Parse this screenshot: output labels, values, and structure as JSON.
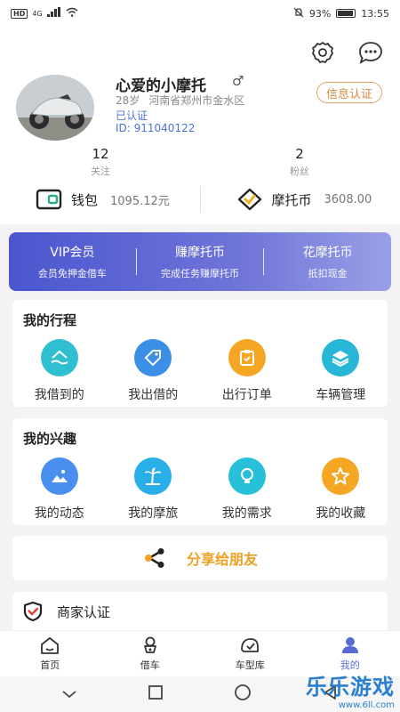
{
  "status_bar": {
    "hd": "HD",
    "network": "4G",
    "battery": "93%",
    "battery_level": 0.93,
    "time": "13:55"
  },
  "profile": {
    "name": "心爱的小摩托",
    "gender_symbol": "♂",
    "age": "28岁",
    "location": "河南省郑州市金水区",
    "verified_text": "已认证",
    "id_text": "ID: 911040122",
    "cert_button": "信息认证"
  },
  "stats": {
    "following_count": "12",
    "following_label": "关注",
    "fans_count": "2",
    "fans_label": "粉丝"
  },
  "wallet": {
    "wallet_label": "钱包",
    "wallet_value": "1095.12元",
    "coin_label": "摩托币",
    "coin_value": "3608.00"
  },
  "vip_banner": [
    {
      "title": "VIP会员",
      "sub": "会员免押金借车"
    },
    {
      "title": "赚摩托币",
      "sub": "完成任务赚摩托币"
    },
    {
      "title": "花摩托币",
      "sub": "抵扣现金"
    }
  ],
  "trips": {
    "title": "我的行程",
    "items": [
      {
        "label": "我借到的",
        "icon": "borrowed-icon",
        "color": "#2fbfd0"
      },
      {
        "label": "我出借的",
        "icon": "tag-icon",
        "color": "#3b8fe6"
      },
      {
        "label": "出行订单",
        "icon": "order-icon",
        "color": "#f5a623"
      },
      {
        "label": "车辆管理",
        "icon": "layers-icon",
        "color": "#27b6d6"
      }
    ]
  },
  "interests": {
    "title": "我的兴趣",
    "items": [
      {
        "label": "我的动态",
        "icon": "image-icon",
        "color": "#4a8ff0"
      },
      {
        "label": "我的摩旅",
        "icon": "palm-tree-icon",
        "color": "#2aaee8"
      },
      {
        "label": "我的需求",
        "icon": "bulb-icon",
        "color": "#27c0d8"
      },
      {
        "label": "我的收藏",
        "icon": "star-icon",
        "color": "#f5a623"
      }
    ]
  },
  "share": {
    "label": "分享给朋友",
    "color": "#f0a020"
  },
  "merchant": {
    "label": "商家认证"
  },
  "tabs": [
    {
      "label": "首页",
      "icon": "home-icon"
    },
    {
      "label": "借车",
      "icon": "scooter-icon"
    },
    {
      "label": "车型库",
      "icon": "helmet-icon"
    },
    {
      "label": "我的",
      "icon": "user-icon",
      "active": true
    }
  ],
  "watermark": {
    "title": "乐乐游戏",
    "url": "www.6ll.com"
  },
  "colors": {
    "accent": "#5b6bd6",
    "link": "#4a73d8",
    "orange": "#d98a3f"
  }
}
